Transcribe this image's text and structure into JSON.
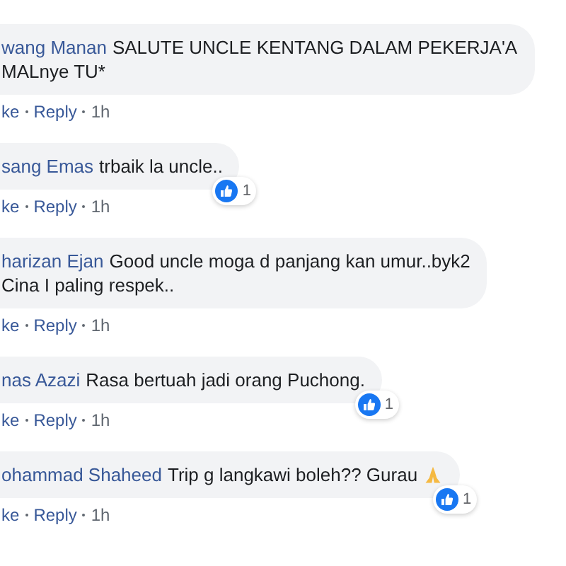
{
  "comments": [
    {
      "name": "wang Manan",
      "lines": [
        "SALUTE UNCLE KENTANG DALAM PEKERJA'A",
        "MALnye TU*"
      ],
      "actions": [
        "ke",
        "Reply",
        "1h"
      ]
    },
    {
      "name": "sang Emas",
      "lines": [
        "trbaik la uncle.."
      ],
      "actions": [
        "ke",
        "Reply",
        "1h"
      ],
      "reactions": "1"
    },
    {
      "name": "harizan Ejan",
      "lines": [
        "Good uncle moga d panjang kan umur..byk2",
        "Cina I paling respek.."
      ],
      "actions": [
        "ke",
        "Reply",
        "1h"
      ]
    },
    {
      "name": "nas Azazi",
      "lines": [
        "Rasa bertuah jadi orang Puchong."
      ],
      "actions": [
        "ke",
        "Reply",
        "1h"
      ],
      "reactions": "1"
    },
    {
      "name": "ohammad Shaheed",
      "lines": [
        "Trip g langkawi boleh?? Gurau"
      ],
      "actions": [
        "ke",
        "Reply",
        "1h"
      ],
      "reactions": "1",
      "trailing_emoji": true
    }
  ]
}
